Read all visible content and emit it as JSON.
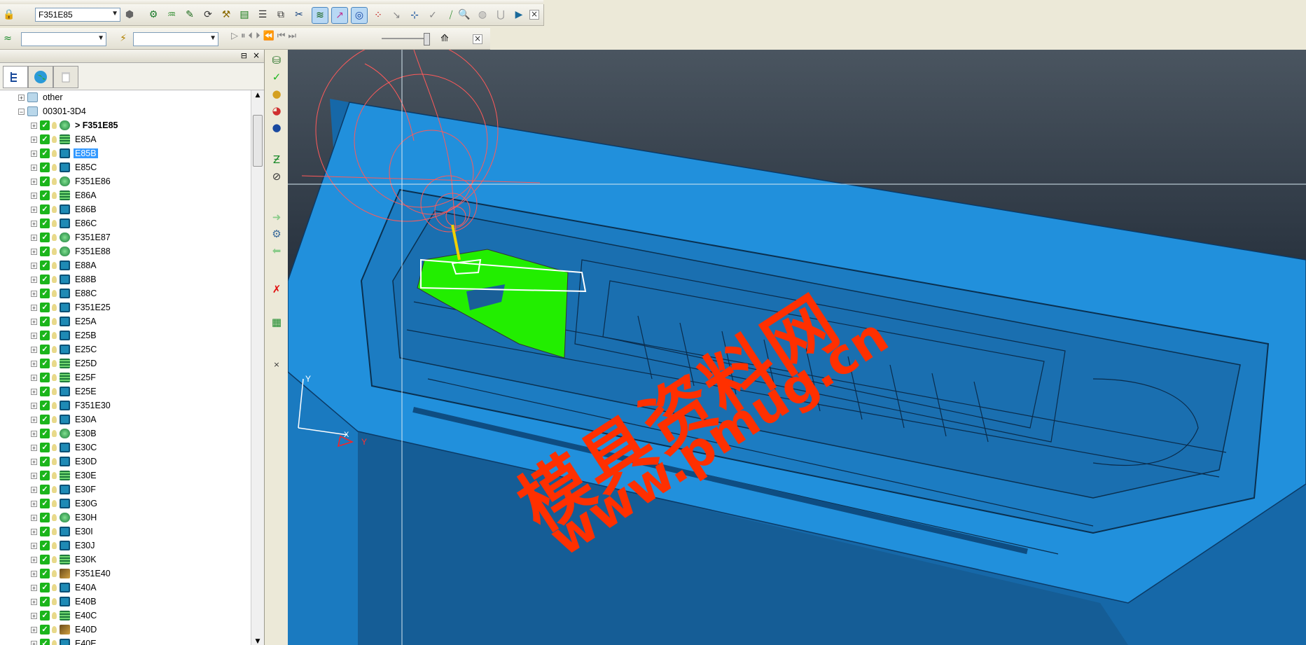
{
  "toolbar": {
    "operation_select": "F351E85",
    "close_symbol": "×"
  },
  "panel": {
    "pin_symbol": "⊟",
    "close_symbol": "×"
  },
  "tree": {
    "items": [
      {
        "label": "other",
        "level": 0,
        "icon": "folder-icon"
      },
      {
        "label": "00301-3D4",
        "level": 0,
        "icon": "folder-icon",
        "expanded": true
      },
      {
        "label": "> F351E85",
        "level": 1,
        "icon": "group-icon",
        "bold": true
      },
      {
        "label": "E85A",
        "level": 1,
        "icon": "operation-icon"
      },
      {
        "label": "E85B",
        "level": 1,
        "icon": "operation-alt-icon",
        "selected": true
      },
      {
        "label": "E85C",
        "level": 1,
        "icon": "operation-alt-icon"
      },
      {
        "label": "F351E86",
        "level": 1,
        "icon": "group-icon"
      },
      {
        "label": "E86A",
        "level": 1,
        "icon": "operation-icon"
      },
      {
        "label": "E86B",
        "level": 1,
        "icon": "operation-alt-icon"
      },
      {
        "label": "E86C",
        "level": 1,
        "icon": "operation-alt-icon"
      },
      {
        "label": "F351E87",
        "level": 1,
        "icon": "group-icon"
      },
      {
        "label": "F351E88",
        "level": 1,
        "icon": "group-icon"
      },
      {
        "label": "E88A",
        "level": 1,
        "icon": "operation-alt-icon"
      },
      {
        "label": "E88B",
        "level": 1,
        "icon": "operation-alt-icon"
      },
      {
        "label": "E88C",
        "level": 1,
        "icon": "operation-alt-icon"
      },
      {
        "label": "F351E25",
        "level": 1,
        "icon": "operation-alt-icon"
      },
      {
        "label": "E25A",
        "level": 1,
        "icon": "operation-alt-icon"
      },
      {
        "label": "E25B",
        "level": 1,
        "icon": "operation-alt-icon"
      },
      {
        "label": "E25C",
        "level": 1,
        "icon": "operation-alt-icon"
      },
      {
        "label": "E25D",
        "level": 1,
        "icon": "operation-icon"
      },
      {
        "label": "E25F",
        "level": 1,
        "icon": "operation-icon"
      },
      {
        "label": "E25E",
        "level": 1,
        "icon": "operation-alt-icon"
      },
      {
        "label": "F351E30",
        "level": 1,
        "icon": "operation-alt-icon"
      },
      {
        "label": "E30A",
        "level": 1,
        "icon": "operation-alt-icon"
      },
      {
        "label": "E30B",
        "level": 1,
        "icon": "group-icon"
      },
      {
        "label": "E30C",
        "level": 1,
        "icon": "operation-alt-icon"
      },
      {
        "label": "E30D",
        "level": 1,
        "icon": "operation-alt-icon"
      },
      {
        "label": "E30E",
        "level": 1,
        "icon": "operation-icon"
      },
      {
        "label": "E30F",
        "level": 1,
        "icon": "operation-alt-icon"
      },
      {
        "label": "E30G",
        "level": 1,
        "icon": "operation-alt-icon"
      },
      {
        "label": "E30H",
        "level": 1,
        "icon": "group-icon"
      },
      {
        "label": "E30I",
        "level": 1,
        "icon": "operation-alt-icon"
      },
      {
        "label": "E30J",
        "level": 1,
        "icon": "operation-alt-icon"
      },
      {
        "label": "E30K",
        "level": 1,
        "icon": "operation-icon"
      },
      {
        "label": "F351E40",
        "level": 1,
        "icon": "brown-icon"
      },
      {
        "label": "E40A",
        "level": 1,
        "icon": "operation-alt-icon"
      },
      {
        "label": "E40B",
        "level": 1,
        "icon": "operation-alt-icon"
      },
      {
        "label": "E40C",
        "level": 1,
        "icon": "operation-icon"
      },
      {
        "label": "E40D",
        "level": 1,
        "icon": "brown-icon"
      },
      {
        "label": "E40E",
        "level": 1,
        "icon": "operation-alt-icon"
      }
    ]
  },
  "viewport": {
    "axis_y_label": "Y",
    "axis_x_label": "X",
    "axis_y2_label": "Y",
    "watermark_line1": "模具资料网",
    "watermark_line2": "www.pmug.cn",
    "colors": {
      "mold": "#1e8bd6",
      "highlight": "#22ee00",
      "tool": "#ff3b3b",
      "watermark": "#ff3000"
    }
  }
}
